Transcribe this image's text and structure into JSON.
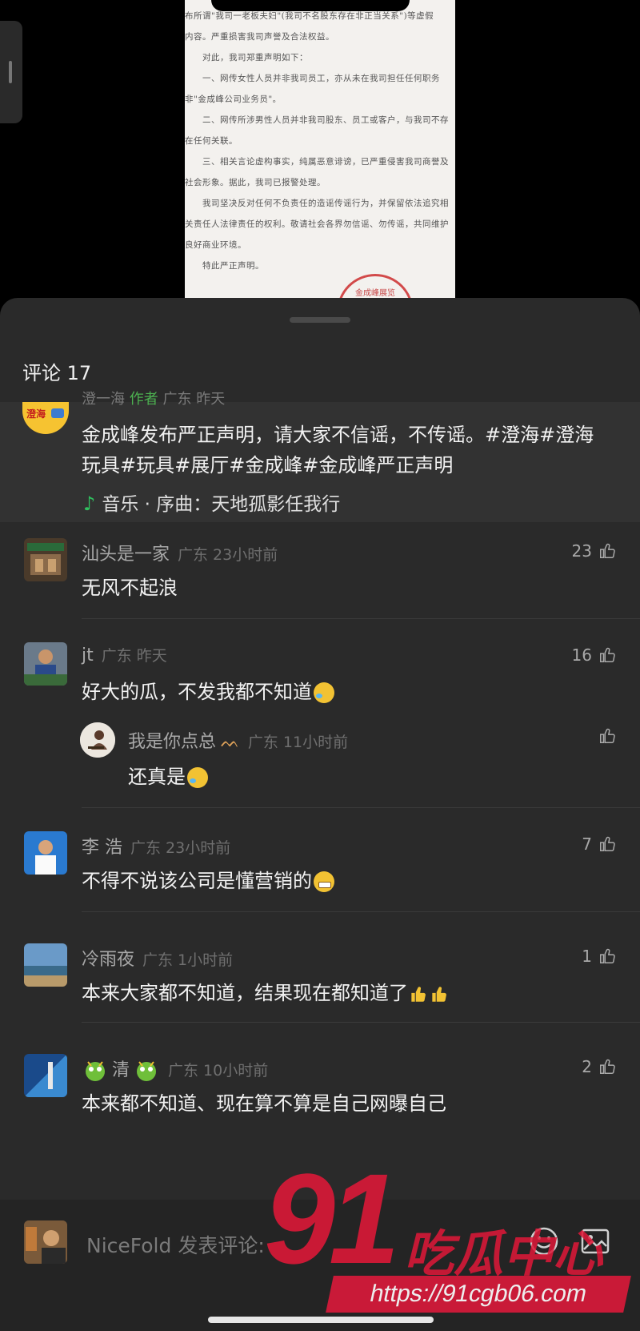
{
  "document_preview": {
    "lines": [
      "布所谓\"我司一老板夫妇\"(我司不名股东存在非正当关系\")等虚假",
      "内容。严重损害我司声誉及合法权益。",
      "对此，我司郑重声明如下：",
      "一、网传女性人员并非我司员工，亦从未在我司担任任何职务",
      "非\"金成峰公司业务员\"。",
      "二、网传所涉男性人员并非我司股东、员工或客户，与我司不存",
      "在任何关联。",
      "三、相关言论虚构事实，纯属恶意诽谤，已严重侵害我司商誉及",
      "社会形象。据此，我司已报警处理。",
      "我司坚决反对任何不负责任的造谣传谣行为，并保留依法追究相",
      "关责任人法律责任的权利。敬请社会各界勿信谣、勿传谣，共同维护",
      "良好商业环境。",
      "特此严正声明。"
    ],
    "seal_text": "金成峰展览"
  },
  "comments_sheet": {
    "title": "评论 17",
    "post": {
      "avatar_text": "澄海",
      "clipped_header": "澄一海 作者 广东 昨天",
      "author_name": "澄一海",
      "author_tag": "作者",
      "author_meta": "广东 昨天",
      "text": "金成峰发布严正声明，请大家不信谣，不传谣。#澄海#澄海玩具#玩具#展厅#金成峰#金成峰严正声明",
      "music": "音乐 · 序曲：天地孤影任我行"
    },
    "comments": [
      {
        "name": "汕头是一家",
        "meta": "广东 23小时前",
        "text": "无风不起浪",
        "likes": "23"
      },
      {
        "name": "jt",
        "meta": "广东 昨天",
        "text": "好大的瓜，不发我都不知道",
        "likes": "16",
        "reply": {
          "name": "我是你点总",
          "meta": "广东 11小时前",
          "text": "还真是",
          "likes": ""
        }
      },
      {
        "name": "李 浩",
        "meta": "广东 23小时前",
        "text": "不得不说该公司是懂营销的",
        "likes": "7"
      },
      {
        "name": "冷雨夜",
        "meta": "广东 1小时前",
        "text": "本来大家都不知道，结果现在都知道了",
        "likes": "1"
      },
      {
        "name": "清",
        "meta": "广东 10小时前",
        "text": "本来都不知道、现在算不算是自己网曝自己",
        "likes": "2"
      }
    ],
    "input_placeholder": "NiceFold 发表评论:"
  },
  "watermark": {
    "big": "91",
    "cn": "吃瓜中心",
    "url": "https://91cgb06.com"
  },
  "colors": {
    "sheet_bg": "#2a2a2a",
    "post_bg": "#323232",
    "author_green": "#4caf50",
    "music_green": "#2fc15f",
    "watermark_red": "#e01838"
  }
}
